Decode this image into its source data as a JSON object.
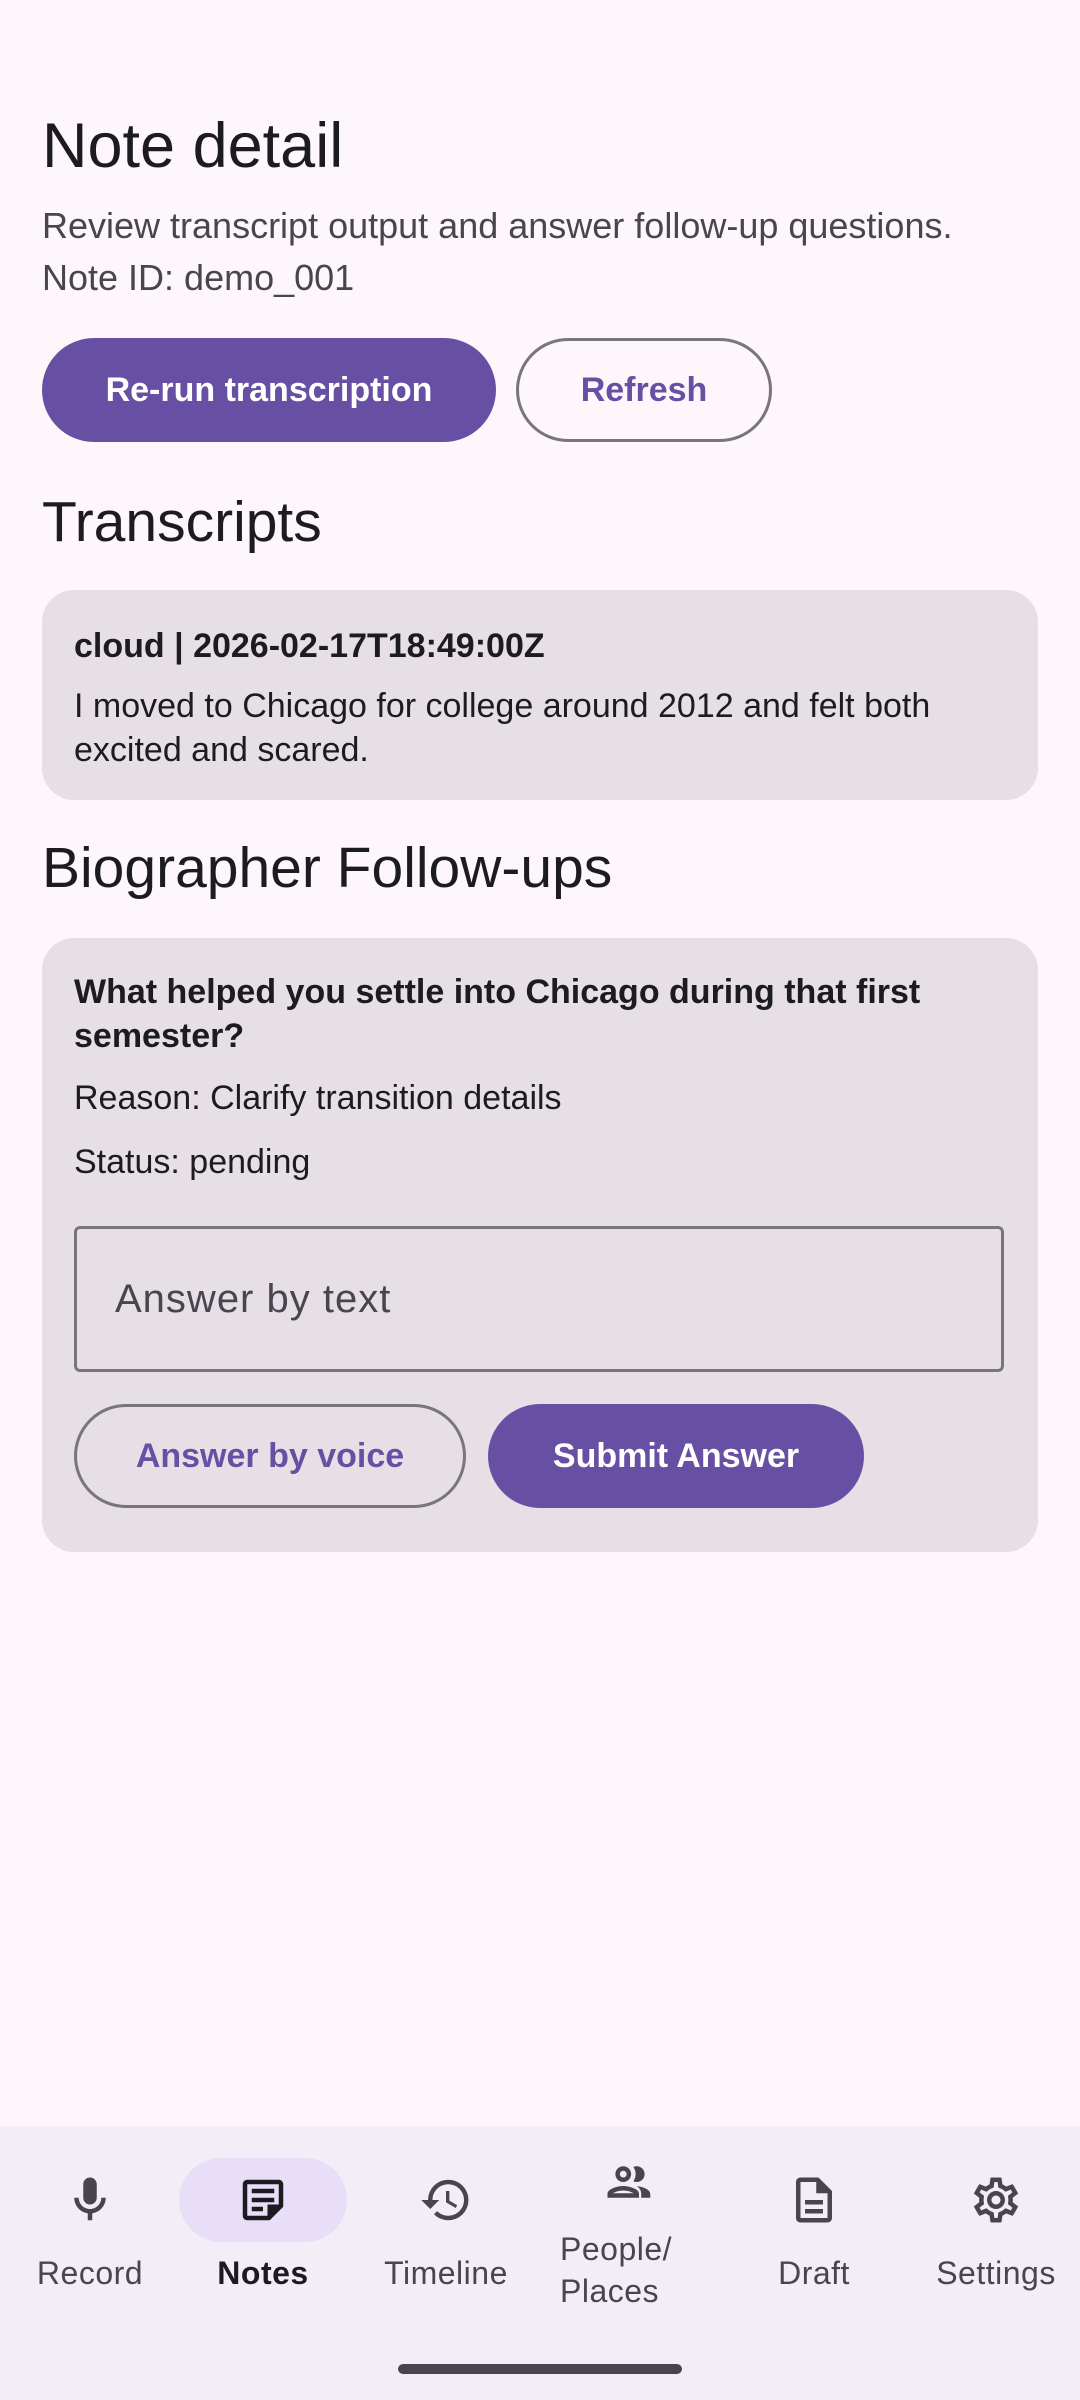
{
  "header": {
    "title": "Note detail",
    "subtitle": "Review transcript output and answer follow-up questions.",
    "note_id": "Note ID: demo_001"
  },
  "actions": {
    "rerun_label": "Re-run transcription",
    "refresh_label": "Refresh"
  },
  "transcripts": {
    "section_title": "Transcripts",
    "items": [
      {
        "meta": "cloud | 2026-02-17T18:49:00Z",
        "text": "I moved to Chicago for college around 2012 and felt both excited and scared."
      }
    ]
  },
  "followups": {
    "section_title": "Biographer Follow-ups",
    "items": [
      {
        "question": "What helped you settle into Chicago during that first semester?",
        "reason": "Reason: Clarify transition details",
        "status": "Status: pending",
        "answer_placeholder": "Answer by text",
        "voice_label": "Answer by voice",
        "submit_label": "Submit Answer"
      }
    ]
  },
  "nav": {
    "items": [
      {
        "label": "Record",
        "icon": "mic-icon"
      },
      {
        "label": "Notes",
        "icon": "notes-icon",
        "active": true
      },
      {
        "label": "Timeline",
        "icon": "history-icon"
      },
      {
        "label": "People/\nPlaces",
        "icon": "people-icon"
      },
      {
        "label": "Draft",
        "icon": "document-icon"
      },
      {
        "label": "Settings",
        "icon": "gear-icon"
      }
    ]
  },
  "colors": {
    "primary": "#6750a4",
    "background": "#fdf7fc",
    "card": "#e6e0e6",
    "nav_bg": "#f3edf7",
    "active_pill": "#e8def8"
  }
}
